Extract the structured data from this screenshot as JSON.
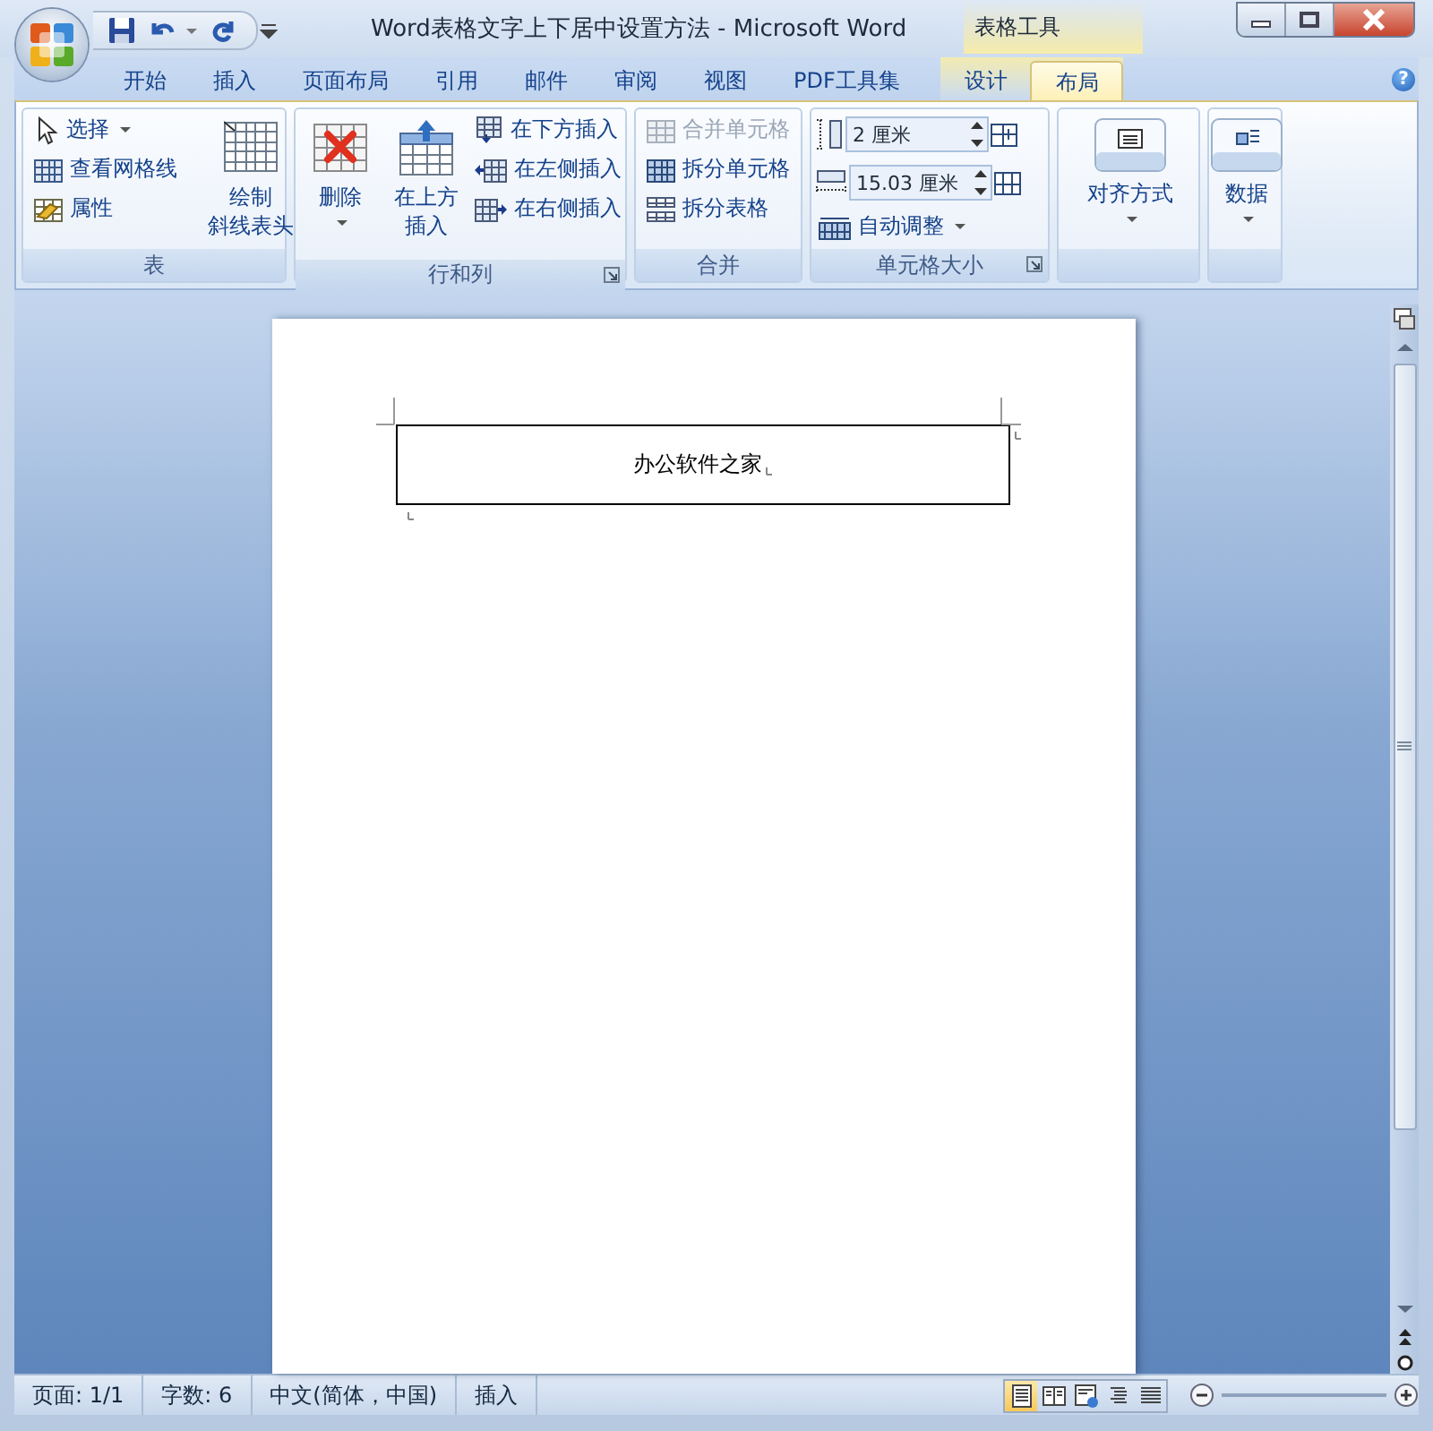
{
  "window": {
    "title": "Word表格文字上下居中设置方法 - Microsoft Word",
    "contextual_label": "表格工具"
  },
  "tabs": [
    {
      "label": "开始",
      "kind": "main",
      "selected": false
    },
    {
      "label": "插入",
      "kind": "main",
      "selected": false
    },
    {
      "label": "页面布局",
      "kind": "main",
      "selected": false
    },
    {
      "label": "引用",
      "kind": "main",
      "selected": false
    },
    {
      "label": "邮件",
      "kind": "main",
      "selected": false
    },
    {
      "label": "审阅",
      "kind": "main",
      "selected": false
    },
    {
      "label": "视图",
      "kind": "main",
      "selected": false
    },
    {
      "label": "PDF工具集",
      "kind": "main",
      "selected": false
    },
    {
      "label": "设计",
      "kind": "contextual",
      "selected": false
    },
    {
      "label": "布局",
      "kind": "contextual",
      "selected": true
    }
  ],
  "help_button": "?",
  "ribbon": {
    "groups": [
      {
        "label": "表",
        "launcher": false,
        "items": [
          {
            "kind": "small",
            "label": "选择",
            "dropdown": true,
            "disabled": false
          },
          {
            "kind": "small",
            "label": "查看网格线",
            "dropdown": false,
            "disabled": false
          },
          {
            "kind": "small",
            "label": "属性",
            "dropdown": false,
            "disabled": false
          },
          {
            "kind": "large",
            "lines": [
              "绘制",
              "斜线表头"
            ],
            "dropdown": false
          }
        ]
      },
      {
        "label": "行和列",
        "launcher": true,
        "items": [
          {
            "kind": "large",
            "lines": [
              "删除"
            ],
            "dropdown": true
          },
          {
            "kind": "large",
            "lines": [
              "在上方",
              "插入"
            ],
            "dropdown": false
          },
          {
            "kind": "small",
            "label": "在下方插入",
            "dropdown": false,
            "disabled": false
          },
          {
            "kind": "small",
            "label": "在左侧插入",
            "dropdown": false,
            "disabled": false
          },
          {
            "kind": "small",
            "label": "在右侧插入",
            "dropdown": false,
            "disabled": false
          }
        ]
      },
      {
        "label": "合并",
        "launcher": false,
        "items": [
          {
            "kind": "small",
            "label": "合并单元格",
            "dropdown": false,
            "disabled": true
          },
          {
            "kind": "small",
            "label": "拆分单元格",
            "dropdown": false,
            "disabled": false
          },
          {
            "kind": "small",
            "label": "拆分表格",
            "dropdown": false,
            "disabled": false
          }
        ]
      },
      {
        "label": "单元格大小",
        "launcher": true,
        "items": [
          {
            "kind": "spinner",
            "value": "2 厘米"
          },
          {
            "kind": "spinner",
            "value": "15.03 厘米"
          },
          {
            "kind": "small",
            "label": "自动调整",
            "dropdown": true,
            "disabled": false
          }
        ]
      },
      {
        "launcher": false,
        "items": [
          {
            "kind": "large",
            "lines": [
              "对齐方式"
            ],
            "dropdown": true
          }
        ]
      },
      {
        "launcher": false,
        "items": [
          {
            "kind": "large",
            "lines": [
              "数据"
            ],
            "dropdown": true
          }
        ]
      }
    ]
  },
  "document": {
    "table_cell": "办公软件之家"
  },
  "status_bar": {
    "items": [
      "页面: 1/1",
      "字数: 6",
      "中文(简体，中国)",
      "插入"
    ],
    "view_buttons": [
      {
        "selected": true
      },
      {
        "selected": false
      },
      {
        "selected": false
      },
      {
        "selected": false
      },
      {
        "selected": false
      }
    ]
  }
}
